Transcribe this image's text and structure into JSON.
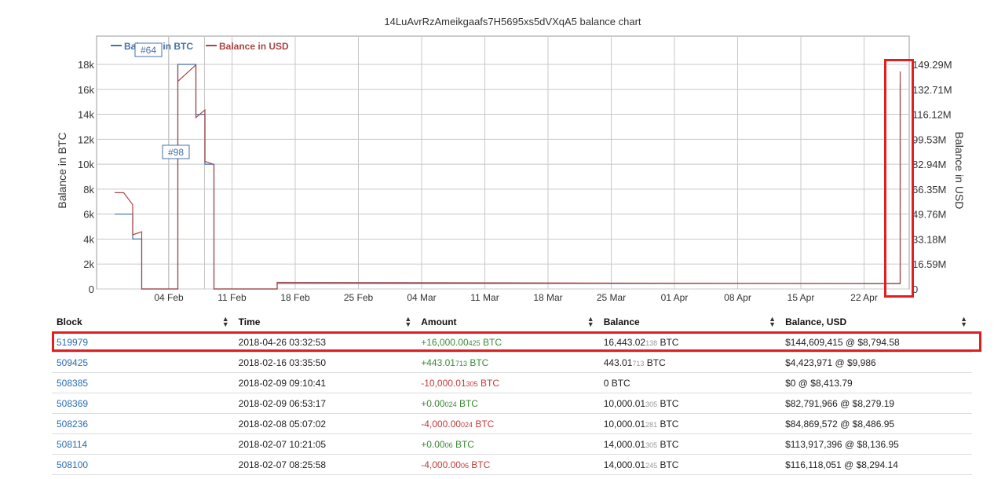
{
  "chart_data": {
    "type": "line",
    "title": "14LuAvrRzAmeikgaafs7H5695xs5dVXqA5 balance chart",
    "ylabel": "Balance in BTC",
    "y2label": "Balance in USD",
    "x_ticks": [
      "04 Feb",
      "11 Feb",
      "18 Feb",
      "25 Feb",
      "04 Mar",
      "11 Mar",
      "18 Mar",
      "25 Mar",
      "01 Apr",
      "08 Apr",
      "15 Apr",
      "22 Apr"
    ],
    "y_ticks": [
      "0",
      "2k",
      "4k",
      "6k",
      "8k",
      "10k",
      "12k",
      "14k",
      "16k",
      "18k"
    ],
    "y2_ticks": [
      "0",
      "16.59M",
      "33.18M",
      "49.76M",
      "66.35M",
      "82.94M",
      "99.53M",
      "116.12M",
      "132.71M",
      "149.29M"
    ],
    "ylim": [
      0,
      18000
    ],
    "y2lim": [
      0,
      149290000
    ],
    "grid": true,
    "legend_position": "top-left",
    "flags": [
      "#64",
      "#98"
    ],
    "series": [
      {
        "name": "Balance in BTC",
        "color": "#4572a7",
        "points": [
          {
            "x": "2018-01-29",
            "y": 6000
          },
          {
            "x": "2018-01-31",
            "y": 6000
          },
          {
            "x": "2018-01-31",
            "y": 4000
          },
          {
            "x": "2018-02-01",
            "y": 4000
          },
          {
            "x": "2018-02-01",
            "y": 0
          },
          {
            "x": "2018-02-05",
            "y": 0
          },
          {
            "x": "2018-02-05",
            "y": 18000
          },
          {
            "x": "2018-02-07",
            "y": 18000
          },
          {
            "x": "2018-02-07",
            "y": 14000
          },
          {
            "x": "2018-02-08",
            "y": 14000
          },
          {
            "x": "2018-02-08",
            "y": 10000
          },
          {
            "x": "2018-02-09",
            "y": 10000
          },
          {
            "x": "2018-02-09",
            "y": 0
          },
          {
            "x": "2018-02-16",
            "y": 0
          },
          {
            "x": "2018-02-16",
            "y": 443
          },
          {
            "x": "2018-04-26",
            "y": 443
          },
          {
            "x": "2018-04-26",
            "y": 16443
          }
        ]
      },
      {
        "name": "Balance in USD",
        "color": "#aa4643",
        "points": [
          {
            "x": "2018-01-29",
            "y": 64000000
          },
          {
            "x": "2018-01-30",
            "y": 64000000
          },
          {
            "x": "2018-01-31",
            "y": 56000000
          },
          {
            "x": "2018-01-31",
            "y": 36000000
          },
          {
            "x": "2018-02-01",
            "y": 38000000
          },
          {
            "x": "2018-02-01",
            "y": 0
          },
          {
            "x": "2018-02-05",
            "y": 0
          },
          {
            "x": "2018-02-05",
            "y": 149290000
          },
          {
            "x": "2018-02-05",
            "y": 138000000
          },
          {
            "x": "2018-02-07",
            "y": 149000000
          },
          {
            "x": "2018-02-07",
            "y": 113917396
          },
          {
            "x": "2018-02-08",
            "y": 119000000
          },
          {
            "x": "2018-02-08",
            "y": 84869572
          },
          {
            "x": "2018-02-09",
            "y": 82791966
          },
          {
            "x": "2018-02-09",
            "y": 0
          },
          {
            "x": "2018-02-16",
            "y": 0
          },
          {
            "x": "2018-02-16",
            "y": 4423971
          },
          {
            "x": "2018-04-26",
            "y": 3500000
          },
          {
            "x": "2018-04-26",
            "y": 144609415
          }
        ]
      }
    ]
  },
  "table": {
    "headers": [
      "Block",
      "Time",
      "Amount",
      "Balance",
      "Balance, USD"
    ],
    "rows": [
      {
        "block": "519979",
        "time": "2018-04-26 03:32:53",
        "amount_main": "+16,000.00",
        "amount_small": "425",
        "amount_unit": " BTC",
        "amount_color": "#3c8a35",
        "balance_main": "16,443.02",
        "balance_small": "138",
        "balance_unit": " BTC",
        "usd": "$144,609,415 @ $8,794.58"
      },
      {
        "block": "509425",
        "time": "2018-02-16 03:35:50",
        "amount_main": "+443.01",
        "amount_small": "713",
        "amount_unit": " BTC",
        "amount_color": "#3c8a35",
        "balance_main": "443.01",
        "balance_small": "713",
        "balance_unit": " BTC",
        "usd": "$4,423,971 @ $9,986"
      },
      {
        "block": "508385",
        "time": "2018-02-09 09:10:41",
        "amount_main": "-10,000.01",
        "amount_small": "305",
        "amount_unit": " BTC",
        "amount_color": "#c43b3b",
        "balance_main": "0 BTC",
        "balance_small": "",
        "balance_unit": "",
        "usd": "$0 @ $8,413.79"
      },
      {
        "block": "508369",
        "time": "2018-02-09 06:53:17",
        "amount_main": "+0.00",
        "amount_small": "024",
        "amount_unit": " BTC",
        "amount_color": "#3c8a35",
        "balance_main": "10,000.01",
        "balance_small": "305",
        "balance_unit": " BTC",
        "usd": "$82,791,966 @ $8,279.19"
      },
      {
        "block": "508236",
        "time": "2018-02-08 05:07:02",
        "amount_main": "-4,000.00",
        "amount_small": "024",
        "amount_unit": " BTC",
        "amount_color": "#c43b3b",
        "balance_main": "10,000.01",
        "balance_small": "281",
        "balance_unit": " BTC",
        "usd": "$84,869,572 @ $8,486.95"
      },
      {
        "block": "508114",
        "time": "2018-02-07 10:21:05",
        "amount_main": "+0.00",
        "amount_small": "06",
        "amount_unit": " BTC",
        "amount_color": "#3c8a35",
        "balance_main": "14,000.01",
        "balance_small": "305",
        "balance_unit": " BTC",
        "usd": "$113,917,396 @ $8,136.95"
      },
      {
        "block": "508100",
        "time": "2018-02-07 08:25:58",
        "amount_main": "-4,000.00",
        "amount_small": "06",
        "amount_unit": " BTC",
        "amount_color": "#c43b3b",
        "balance_main": "14,000.01",
        "balance_small": "245",
        "balance_unit": " BTC",
        "usd": "$116,118,051 @ $8,294.14"
      }
    ]
  }
}
